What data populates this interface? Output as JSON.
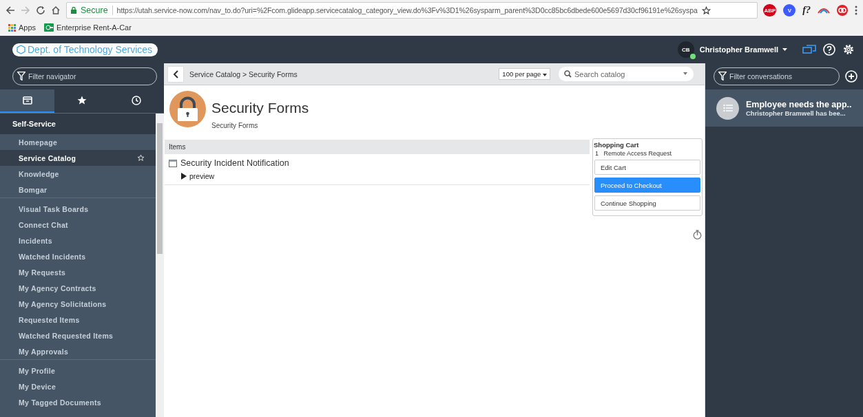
{
  "browser": {
    "security_label": "Secure",
    "url": "https://utah.service-now.com/nav_to.do?uri=%2Fcom.glideapp.servicecatalog_category_view.do%3Fv%3D1%26sysparm_parent%3D0cc85bc6dbede600e5697d30cf96191e%26syspa",
    "extensions": [
      {
        "kind": "badge",
        "label": "ABP",
        "color": "#d0021b"
      },
      {
        "kind": "badge",
        "label": "V",
        "color": "#3d5afe"
      },
      {
        "kind": "text",
        "label": "f?"
      },
      {
        "kind": "arc"
      },
      {
        "kind": "ring",
        "color": "#e0202a"
      }
    ],
    "bookmarks": [
      {
        "kind": "apps",
        "label": "Apps"
      },
      {
        "kind": "site",
        "label": "Enterprise Rent-A-Car"
      }
    ]
  },
  "header": {
    "logo": "Dept. of Technology Services",
    "user": {
      "initials": "CB",
      "name": "Christopher Bramwell",
      "online": true
    }
  },
  "navigator": {
    "filter_placeholder": "Filter navigator",
    "tabs": [
      {
        "kind": "all",
        "selected": true
      },
      {
        "kind": "favorites",
        "selected": false
      },
      {
        "kind": "history",
        "selected": false
      }
    ],
    "module": "Self-Service",
    "sections": [
      {
        "items": [
          {
            "label": "Homepage",
            "selected": false
          },
          {
            "label": "Service Catalog",
            "selected": true
          },
          {
            "label": "Knowledge",
            "selected": false
          },
          {
            "label": "Bomgar",
            "selected": false
          }
        ]
      },
      {
        "items": [
          {
            "label": "Visual Task Boards",
            "selected": false
          },
          {
            "label": "Connect Chat",
            "selected": false
          },
          {
            "label": "Incidents",
            "selected": false
          },
          {
            "label": "Watched Incidents",
            "selected": false
          },
          {
            "label": "My Requests",
            "selected": false
          },
          {
            "label": "My Agency Contracts",
            "selected": false
          },
          {
            "label": "My Agency Solicitations",
            "selected": false
          },
          {
            "label": "Requested Items",
            "selected": false
          },
          {
            "label": "Watched Requested Items",
            "selected": false
          },
          {
            "label": "My Approvals",
            "selected": false
          }
        ]
      },
      {
        "items": [
          {
            "label": "My Profile",
            "selected": false
          },
          {
            "label": "My Device",
            "selected": false
          },
          {
            "label": "My Tagged Documents",
            "selected": false
          }
        ]
      }
    ]
  },
  "toolbar": {
    "breadcrumb": "Service Catalog > Security Forms",
    "per_page": "100 per page",
    "search_placeholder": "Search catalog"
  },
  "category": {
    "title": "Security Forms",
    "subtitle": "Security Forms"
  },
  "items_header": "Items",
  "items": [
    {
      "title": "Security Incident Notification",
      "preview": "preview"
    }
  ],
  "cart": {
    "title": "Shopping Cart",
    "entries": [
      {
        "quantity": "1",
        "name": "Remote Access Request"
      }
    ],
    "buttons": [
      {
        "label": "Edit Cart",
        "primary": false
      },
      {
        "label": "Proceed to Checkout",
        "primary": true
      },
      {
        "label": "Continue Shopping",
        "primary": false
      }
    ]
  },
  "conversations": {
    "filter_placeholder": "Filter conversations",
    "items": [
      {
        "title": "Employee needs the app..",
        "subtitle": "Christopher Bramwell has bee..."
      }
    ]
  }
}
